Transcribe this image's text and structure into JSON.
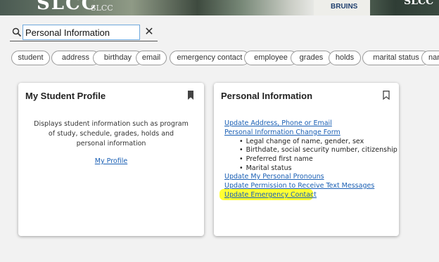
{
  "banner": {
    "logo": "SLCC",
    "logo_sub": "SLCC",
    "shirt_text": "BRUINS",
    "corner_text": "SLCC"
  },
  "search": {
    "value": "Personal Information",
    "placeholder": "Search"
  },
  "chips": [
    "student",
    "address",
    "birthday",
    "email",
    "emergency contact",
    "employee",
    "grades",
    "holds",
    "marital status",
    "name"
  ],
  "cards": [
    {
      "title": "My Student Profile",
      "description": "Displays student information such as program of study, schedule, grades, holds and personal information",
      "link": "My Profile",
      "bookmarked": true
    },
    {
      "title": "Personal Information",
      "bookmarked": false,
      "links": {
        "update_address": "Update Address, Phone or Email",
        "change_form": "Personal Information Change Form",
        "update_pronouns": "Update My Personal Pronouns",
        "update_permission": "Update Permission to Receive Text Messages",
        "update_emergency": "Update Emergency Contact"
      },
      "bullets": [
        "Legal change of name, gender, sex",
        "Birthdate, social security number, citizenship",
        "Preferred first name",
        "Marital status"
      ]
    }
  ],
  "colors": {
    "link": "#1a5fb4",
    "highlight": "#ffff33",
    "input_border": "#6fa8dc"
  }
}
